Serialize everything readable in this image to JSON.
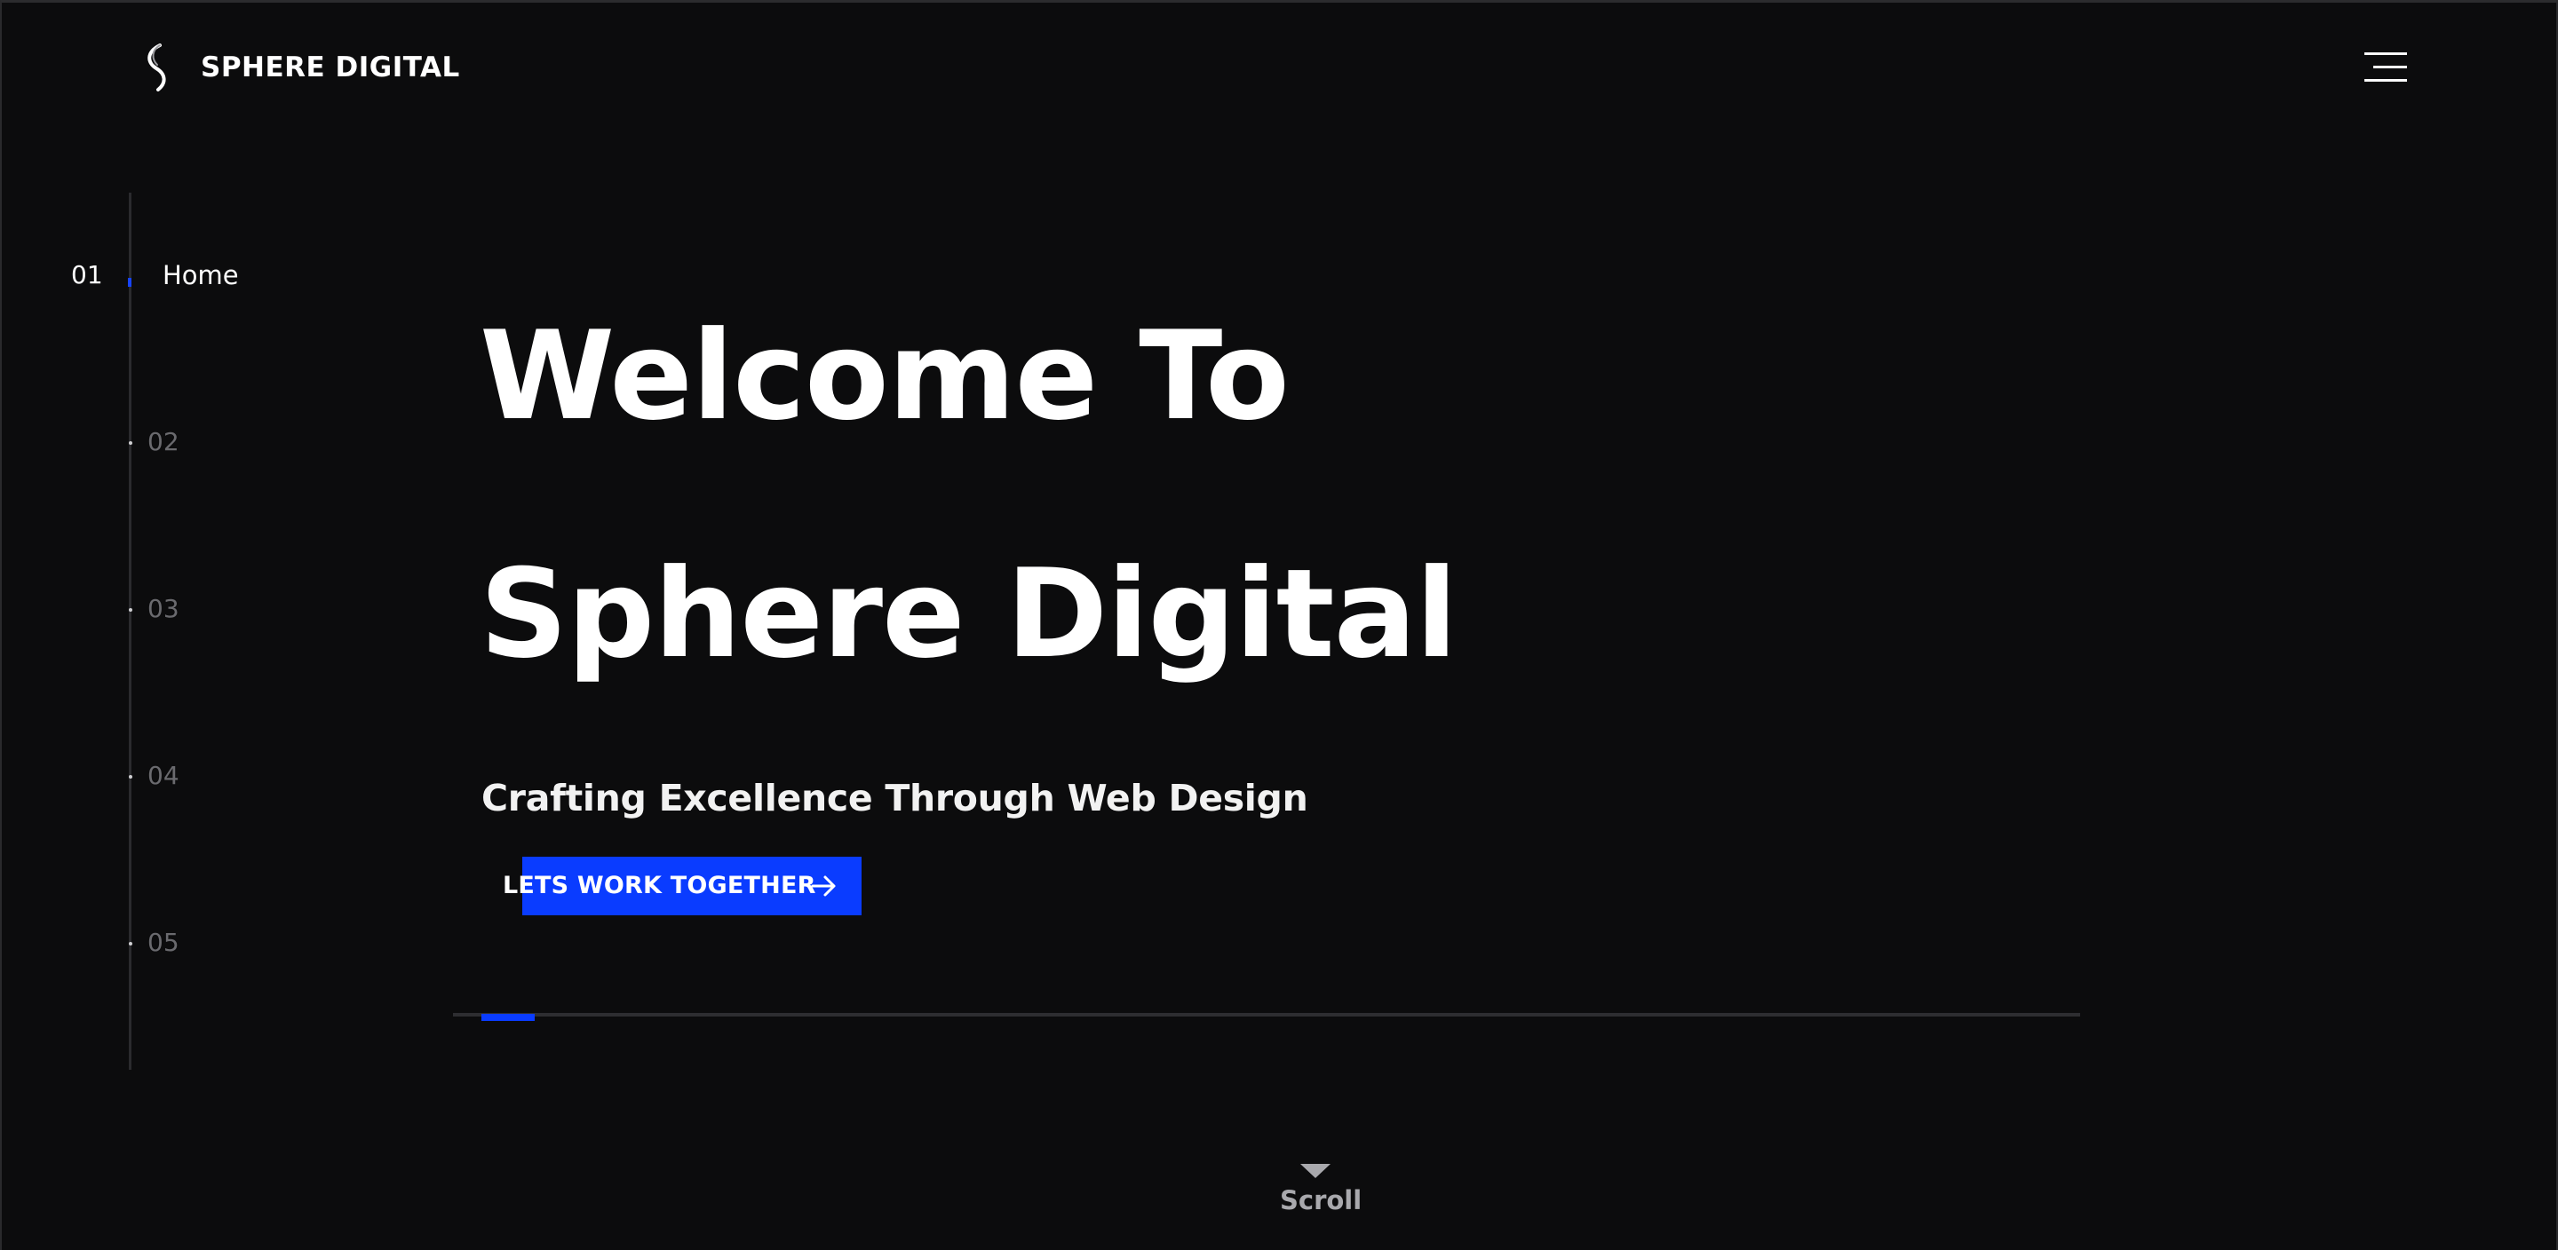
{
  "header": {
    "brand_name": "SPHERE DIGITAL",
    "logo_icon": "s-monogram-icon",
    "menu_icon": "hamburger-menu-icon"
  },
  "section_nav": {
    "active_index": 0,
    "items": [
      {
        "number": "01",
        "label": "Home"
      },
      {
        "number": "02",
        "label": ""
      },
      {
        "number": "03",
        "label": ""
      },
      {
        "number": "04",
        "label": ""
      },
      {
        "number": "05",
        "label": ""
      }
    ]
  },
  "hero": {
    "title_line1": "Welcome To",
    "title_line2": "Sphere Digital",
    "subtitle": "Crafting Excellence Through Web Design",
    "cta_label": "LETS WORK TOGETHER",
    "cta_icon": "arrow-right-icon"
  },
  "slider": {
    "progress": 0.033
  },
  "scroll_hint": {
    "label": "Scroll",
    "icon": "caret-down-icon"
  },
  "colors": {
    "background": "#0c0c0d",
    "accent": "#0a3cff",
    "text": "#ffffff",
    "muted": "#6a6a6e"
  }
}
